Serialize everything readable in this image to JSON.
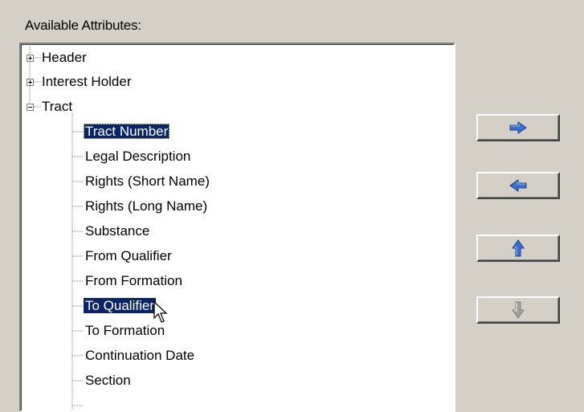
{
  "group_label": "Available Attributes:",
  "tree": {
    "nodes": [
      {
        "label": "Header",
        "level": 0,
        "expander": "plus"
      },
      {
        "label": "Interest Holder",
        "level": 0,
        "expander": "plus"
      },
      {
        "label": "Tract",
        "level": 0,
        "expander": "minus"
      },
      {
        "label": "Tract Number",
        "level": 1,
        "selected": true,
        "focus": true
      },
      {
        "label": "Legal Description",
        "level": 1
      },
      {
        "label": "Rights (Short Name)",
        "level": 1
      },
      {
        "label": "Rights (Long Name)",
        "level": 1
      },
      {
        "label": "Substance",
        "level": 1
      },
      {
        "label": "From Qualifier",
        "level": 1
      },
      {
        "label": "From Formation",
        "level": 1
      },
      {
        "label": "To Qualifier",
        "level": 1,
        "selected": true
      },
      {
        "label": "To Formation",
        "level": 1
      },
      {
        "label": "Continuation Date",
        "level": 1
      },
      {
        "label": "Section",
        "level": 1
      }
    ]
  },
  "buttons": [
    {
      "icon": "arrow-right-icon",
      "color": "#3a6fd0",
      "enabled": true
    },
    {
      "icon": "arrow-left-icon",
      "color": "#3a6fd0",
      "enabled": true
    },
    {
      "icon": "arrow-up-icon",
      "color": "#3a6fd0",
      "enabled": true
    },
    {
      "icon": "arrow-down-icon",
      "color": "#9a9a9a",
      "enabled": false
    }
  ],
  "colors": {
    "selection": "#0a246a",
    "window": "#d4d0c8"
  }
}
